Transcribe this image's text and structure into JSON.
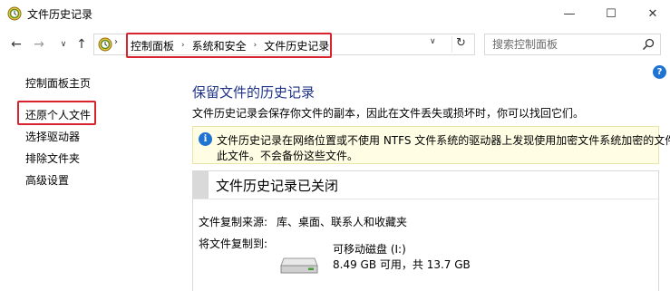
{
  "window": {
    "title": "文件历史记录",
    "minimize_glyph": "—",
    "maximize_glyph": "☐",
    "close_glyph": "✕"
  },
  "nav": {
    "back_glyph": "←",
    "forward_glyph": "→",
    "recent_glyph": "∨",
    "up_glyph": "↑",
    "breadcrumb": [
      "控制面板",
      "系统和安全",
      "文件历史记录"
    ],
    "separator_glyph": "›",
    "dropdown_glyph": "∨",
    "refresh_glyph": "↻",
    "search_placeholder": "搜索控制面板"
  },
  "help": {
    "glyph": "?"
  },
  "sidebar": {
    "items": [
      {
        "label": "控制面板主页"
      },
      {
        "label": "还原个人文件"
      },
      {
        "label": "选择驱动器"
      },
      {
        "label": "排除文件夹"
      },
      {
        "label": "高级设置"
      }
    ]
  },
  "main": {
    "title": "保留文件的历史记录",
    "description": "文件历史记录会保存你文件的副本，因此在文件丢失或损坏时，你可以找回它们。",
    "info": {
      "glyph": "i",
      "line1": "文件历史记录在网络位置或不使用 NTFS 文件系统的驱动器上发现使用加密文件系统加密的文件。",
      "line2": "此文件。不会备份这些文件。"
    },
    "status": {
      "title": "文件历史记录已关闭",
      "source_label": "文件复制来源:",
      "source_value": "库、桌面、联系人和收藏夹",
      "target_label": "将文件复制到:",
      "drive_name": "可移动磁盘 (I:)",
      "drive_space": "8.49 GB 可用，共 13.7 GB"
    }
  },
  "colors": {
    "highlight_border": "#d9232e",
    "title_blue": "#1e3287",
    "info_background": "#fffee5",
    "help_blue": "#1e73d3"
  }
}
